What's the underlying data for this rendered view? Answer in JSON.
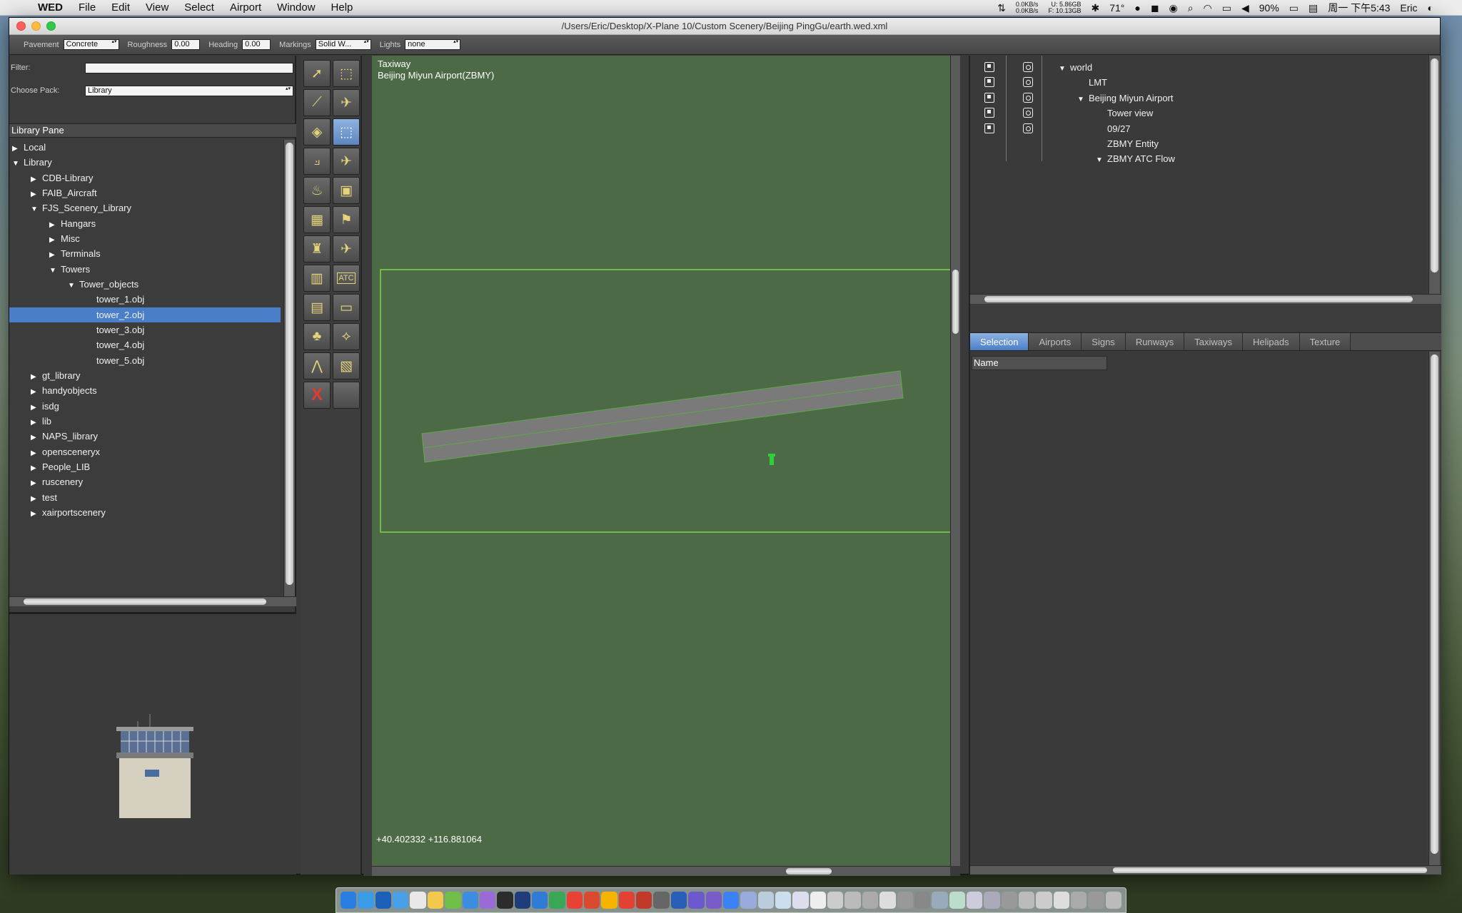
{
  "menubar": {
    "app_name": "WED",
    "items": [
      "File",
      "Edit",
      "View",
      "Select",
      "Airport",
      "Window",
      "Help"
    ],
    "net_up": "0.0KB/s",
    "net_down": "0.0KB/s",
    "mem_used": "U: 5.86GB",
    "mem_free": "F: 10.13GB",
    "temperature": "71°",
    "battery": "90%",
    "datetime": "周一 下午5:43",
    "user": "Eric"
  },
  "window": {
    "title": "/Users/Eric/Desktop/X-Plane 10/Custom Scenery/Beijing PingGu/earth.wed.xml"
  },
  "toolbar": {
    "pavement_label": "Pavement",
    "pavement_value": "Concrete",
    "roughness_label": "Roughness",
    "roughness_value": "0.00",
    "heading_label": "Heading",
    "heading_value": "0.00",
    "markings_label": "Markings",
    "markings_value": "Solid W...",
    "lights_label": "Lights",
    "lights_value": "none"
  },
  "library": {
    "filter_label": "Filter:",
    "filter_value": "",
    "pack_label": "Choose Pack:",
    "pack_value": "Library",
    "pane_title": "Library Pane",
    "tree": [
      {
        "label": "Local",
        "indent": 0,
        "state": "closed"
      },
      {
        "label": "Library",
        "indent": 0,
        "state": "open"
      },
      {
        "label": "CDB-Library",
        "indent": 1,
        "state": "closed"
      },
      {
        "label": "FAIB_Aircraft",
        "indent": 1,
        "state": "closed"
      },
      {
        "label": "FJS_Scenery_Library",
        "indent": 1,
        "state": "open"
      },
      {
        "label": "Hangars",
        "indent": 2,
        "state": "closed"
      },
      {
        "label": "Misc",
        "indent": 2,
        "state": "closed"
      },
      {
        "label": "Terminals",
        "indent": 2,
        "state": "closed"
      },
      {
        "label": "Towers",
        "indent": 2,
        "state": "open"
      },
      {
        "label": "Tower_objects",
        "indent": 3,
        "state": "open"
      },
      {
        "label": "tower_1.obj",
        "indent": 4,
        "state": "leaf"
      },
      {
        "label": "tower_2.obj",
        "indent": 4,
        "state": "leaf",
        "selected": true
      },
      {
        "label": "tower_3.obj",
        "indent": 4,
        "state": "leaf"
      },
      {
        "label": "tower_4.obj",
        "indent": 4,
        "state": "leaf"
      },
      {
        "label": "tower_5.obj",
        "indent": 4,
        "state": "leaf"
      },
      {
        "label": "gt_library",
        "indent": 1,
        "state": "closed"
      },
      {
        "label": "handyobjects",
        "indent": 1,
        "state": "closed"
      },
      {
        "label": "isdg",
        "indent": 1,
        "state": "closed"
      },
      {
        "label": "lib",
        "indent": 1,
        "state": "closed"
      },
      {
        "label": "NAPS_library",
        "indent": 1,
        "state": "closed"
      },
      {
        "label": "opensceneryx",
        "indent": 1,
        "state": "closed"
      },
      {
        "label": "People_LIB",
        "indent": 1,
        "state": "closed"
      },
      {
        "label": "ruscenery",
        "indent": 1,
        "state": "closed"
      },
      {
        "label": "test",
        "indent": 1,
        "state": "closed"
      },
      {
        "label": "xairportscenery",
        "indent": 1,
        "state": "closed"
      }
    ]
  },
  "tools": [
    {
      "name": "marquee-arrow-tool",
      "glyph": "➚"
    },
    {
      "name": "vertex-select-tool",
      "glyph": "⬚"
    },
    {
      "name": "runway-tool",
      "glyph": "⟋"
    },
    {
      "name": "helipad-tool",
      "glyph": "✈"
    },
    {
      "name": "sealane-tool",
      "glyph": "◈"
    },
    {
      "name": "taxiway-tool",
      "glyph": "⬚",
      "active": true
    },
    {
      "name": "taxiline-tool",
      "glyph": "⟓"
    },
    {
      "name": "boundary-tool",
      "glyph": "✈"
    },
    {
      "name": "light-tool",
      "glyph": "♨"
    },
    {
      "name": "sign-tool",
      "glyph": "▣"
    },
    {
      "name": "object-tool",
      "glyph": "▦"
    },
    {
      "name": "windsock-tool",
      "glyph": "⚑"
    },
    {
      "name": "tower-viewpoint-tool",
      "glyph": "♜"
    },
    {
      "name": "ramp-start-tool",
      "glyph": "✈"
    },
    {
      "name": "facade-tool",
      "glyph": "▥"
    },
    {
      "name": "atc-flow-tool",
      "glyph": "ATC"
    },
    {
      "name": "forest-tool",
      "glyph": "▤"
    },
    {
      "name": "polygon-tool",
      "glyph": "▭"
    },
    {
      "name": "tree-tool",
      "glyph": "♣"
    },
    {
      "name": "string-tool",
      "glyph": "⟡"
    },
    {
      "name": "line-tool",
      "glyph": "⋀"
    },
    {
      "name": "draped-polygon-tool",
      "glyph": "▧"
    },
    {
      "name": "delete-tool",
      "glyph": "X",
      "delete": true
    },
    {
      "name": "empty-tool-slot",
      "glyph": ""
    }
  ],
  "map": {
    "layer_label": "Taxiway",
    "airport_label": "Beijing Miyun Airport(ZBMY)",
    "coordinates": "+40.402332 +116.881064"
  },
  "hierarchy": [
    {
      "label": "world",
      "indent": 0,
      "state": "open"
    },
    {
      "label": "LMT",
      "indent": 1,
      "state": "leaf"
    },
    {
      "label": "Beijing Miyun Airport",
      "indent": 1,
      "state": "open"
    },
    {
      "label": "Tower view",
      "indent": 2,
      "state": "leaf"
    },
    {
      "label": "09/27",
      "indent": 2,
      "state": "leaf"
    },
    {
      "label": "ZBMY Entity",
      "indent": 2,
      "state": "leaf"
    },
    {
      "label": "ZBMY ATC Flow",
      "indent": 2,
      "state": "open"
    }
  ],
  "tabs": [
    {
      "label": "Selection",
      "active": true
    },
    {
      "label": "Airports"
    },
    {
      "label": "Signs"
    },
    {
      "label": "Runways"
    },
    {
      "label": "Taxiways"
    },
    {
      "label": "Helipads"
    },
    {
      "label": "Texture"
    }
  ],
  "properties": {
    "name_column": "Name"
  },
  "colors": {
    "selection": "#4a7ec9",
    "map_ground": "#4b6a45",
    "boundary": "#7cd64a",
    "runway": "#777777"
  }
}
